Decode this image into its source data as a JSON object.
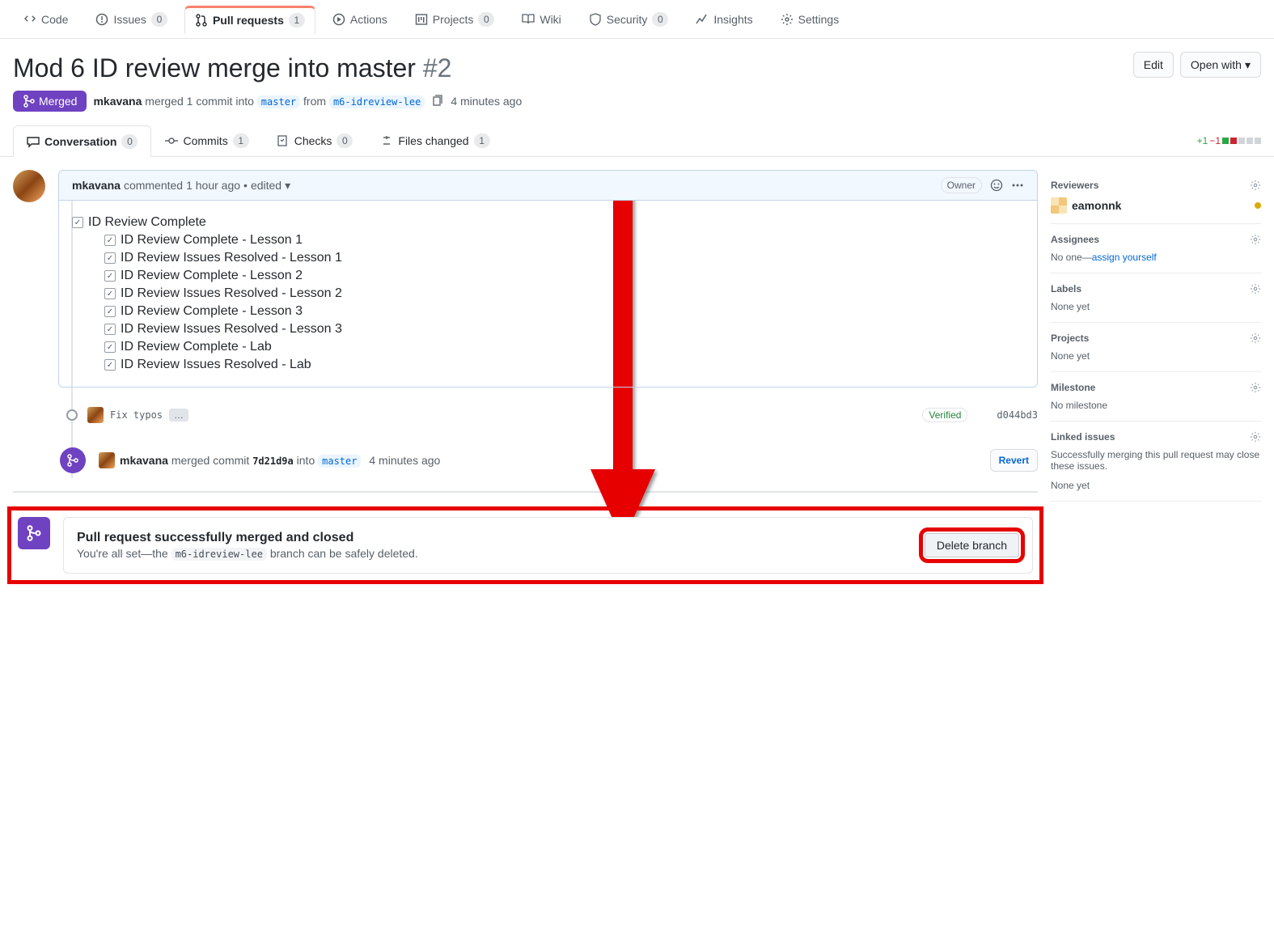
{
  "repoNav": {
    "code": "Code",
    "issues": "Issues",
    "issuesCount": "0",
    "pulls": "Pull requests",
    "pullsCount": "1",
    "actions": "Actions",
    "projects": "Projects",
    "projectsCount": "0",
    "wiki": "Wiki",
    "security": "Security",
    "securityCount": "0",
    "insights": "Insights",
    "settings": "Settings"
  },
  "header": {
    "title": "Mod 6 ID review merge into master",
    "number": "#2",
    "editBtn": "Edit",
    "openWithBtn": "Open with",
    "state": "Merged",
    "author": "mkavana",
    "mergedText1": " merged 1 commit into ",
    "baseBranch": "master",
    "fromText": " from ",
    "headBranch": "m6-idreview-lee",
    "timeAgo": "4 minutes ago"
  },
  "subnav": {
    "conversation": "Conversation",
    "conversationCount": "0",
    "commits": "Commits",
    "commitsCount": "1",
    "checks": "Checks",
    "checksCount": "0",
    "filesChanged": "Files changed",
    "filesChangedCount": "1",
    "plus": "+1",
    "minus": "−1"
  },
  "comment": {
    "author": "mkavana",
    "action": " commented ",
    "time": "1 hour ago",
    "edited": "edited",
    "ownerLabel": "Owner",
    "tasks": {
      "root": "ID Review Complete",
      "items": [
        "ID Review Complete - Lesson 1",
        "ID Review Issues Resolved - Lesson 1",
        "ID Review Complete - Lesson 2",
        "ID Review Issues Resolved - Lesson 2",
        "ID Review Complete - Lesson 3",
        "ID Review Issues Resolved - Lesson 3",
        "ID Review Complete - Lab",
        "ID Review Issues Resolved - Lab"
      ]
    }
  },
  "commitEvent": {
    "msg": "Fix typos",
    "verified": "Verified",
    "sha": "d044bd3"
  },
  "mergeEvent": {
    "author": "mkavana",
    "text1": " merged commit ",
    "sha": "7d21d9a",
    "text2": " into ",
    "branch": "master",
    "time": "4 minutes ago",
    "revertBtn": "Revert"
  },
  "mergedBox": {
    "title": "Pull request successfully merged and closed",
    "text1": "You're all set—the ",
    "branch": "m6-idreview-lee",
    "text2": " branch can be safely deleted.",
    "deleteBtn": "Delete branch"
  },
  "sidebar": {
    "reviewers": {
      "title": "Reviewers",
      "name": "eamonnk"
    },
    "assignees": {
      "title": "Assignees",
      "text": "No one—",
      "link": "assign yourself"
    },
    "labels": {
      "title": "Labels",
      "text": "None yet"
    },
    "projects": {
      "title": "Projects",
      "text": "None yet"
    },
    "milestone": {
      "title": "Milestone",
      "text": "No milestone"
    },
    "linked": {
      "title": "Linked issues",
      "desc": "Successfully merging this pull request may close these issues.",
      "text": "None yet"
    }
  }
}
